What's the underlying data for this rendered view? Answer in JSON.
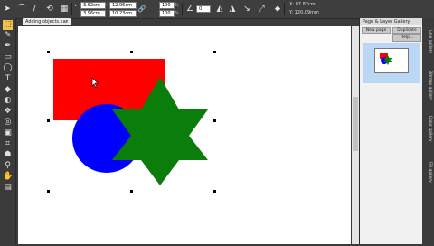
{
  "toolbar": {
    "x_value": "3.62cm",
    "y_value": "3.96cm",
    "w_value": "12.96cm",
    "h_value": "10.23cm",
    "scale_w": "100",
    "scale_h": "100",
    "pct": "%",
    "angle_value": "0",
    "coord_x": "X: 87.82cm",
    "coord_y": "Y: 120.09mm"
  },
  "document_tab": {
    "title": "Adding objects.xar",
    "close": "×"
  },
  "tools": [
    "selector-tool",
    "shape-editor-tool",
    "pen-tool",
    "rectangle-tool",
    "ellipse-tool",
    "text-tool",
    "fill-tool",
    "transparency-tool",
    "blend-tool",
    "contour-tool",
    "bevel-tool",
    "mould-tool",
    "shadow-tool",
    "zoom-tool",
    "push-tool",
    "color-tool"
  ],
  "gallery": {
    "title": "Page & Layer Gallery",
    "new_page": "New page",
    "duplicate": "Duplicate",
    "help": "Help..."
  },
  "side_tabs": [
    "Line gallery",
    "Bitmap gallery",
    "Color gallery",
    "Fill gallery"
  ],
  "colors": {
    "red": "#ff0000",
    "blue": "#0000ff",
    "green": "#0a7d0a",
    "accent": "#f3c14d"
  }
}
